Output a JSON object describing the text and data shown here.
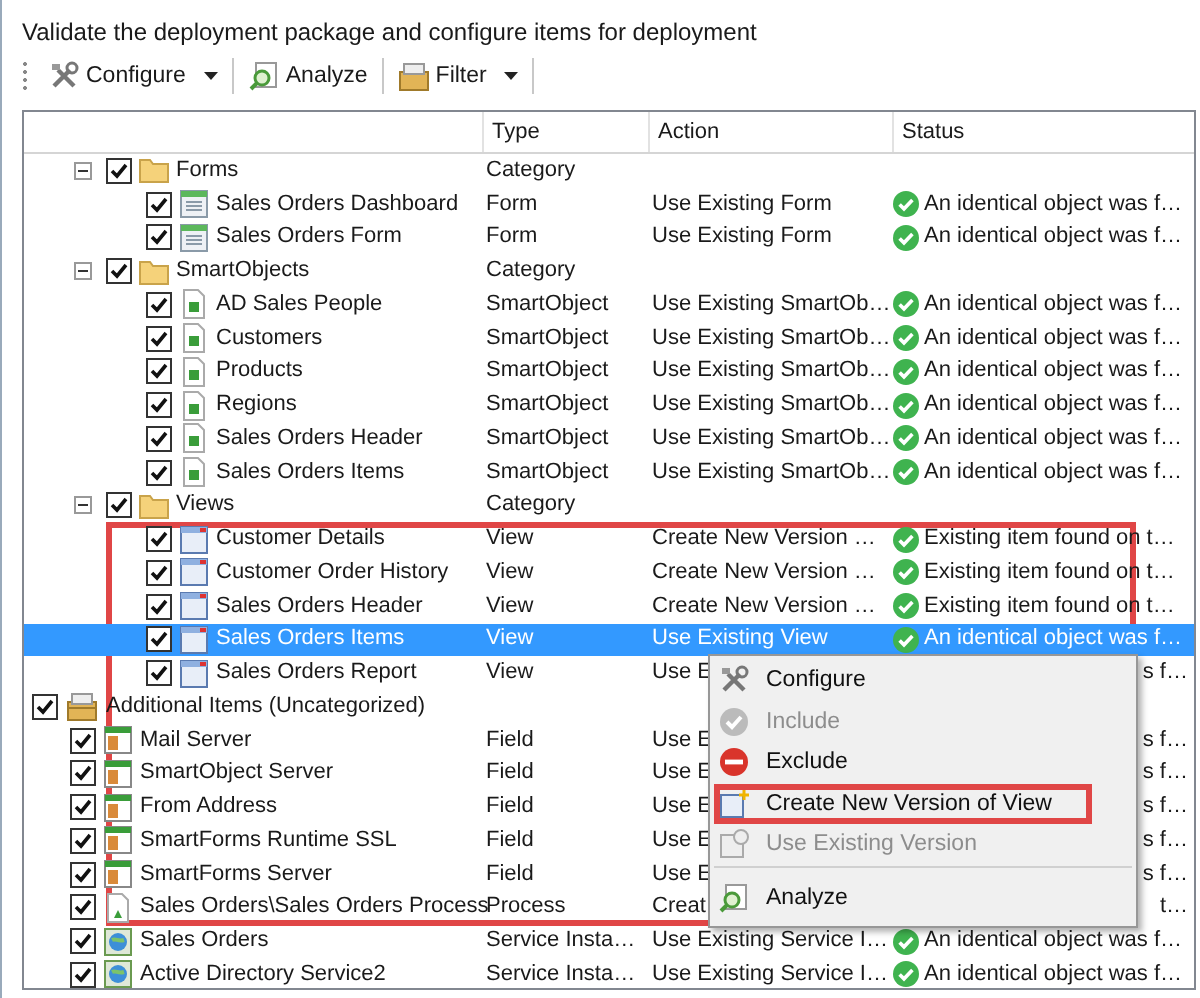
{
  "heading": "Validate the deployment package and configure items for deployment",
  "toolbar": [
    {
      "label": "Configure",
      "kind": "configure",
      "dropdown": true
    },
    {
      "label": "Analyze",
      "kind": "analyze",
      "dropdown": false
    },
    {
      "label": "Filter",
      "kind": "filter",
      "dropdown": true
    }
  ],
  "columns": [
    "Type",
    "Action",
    "Status"
  ],
  "tree": [
    {
      "children": [
        {
          "children": [
            {
              "label": "Forms",
              "kind": "folder",
              "checked": true,
              "expanded": true,
              "selected": false,
              "type": "Category",
              "children": [
                {
                  "label": "Sales Orders Dashboard",
                  "kind": "form",
                  "checked": true,
                  "selected": false,
                  "type": "Form",
                  "action": "Use Existing Form",
                  "status": {
                    "text": "An identical object was f…",
                    "partial": false
                  }
                },
                {
                  "label": "Sales Orders Form",
                  "kind": "form",
                  "checked": true,
                  "selected": false,
                  "type": "Form",
                  "action": "Use Existing Form",
                  "status": {
                    "text": "An identical object was f…",
                    "partial": false
                  }
                }
              ]
            },
            {
              "label": "SmartObjects",
              "kind": "folder",
              "checked": true,
              "expanded": true,
              "selected": false,
              "type": "Category",
              "children": [
                {
                  "label": "AD Sales People",
                  "kind": "smartobject",
                  "checked": true,
                  "selected": false,
                  "type": "SmartObject",
                  "action": "Use Existing SmartOb…",
                  "status": {
                    "text": "An identical object was f…",
                    "partial": false
                  }
                },
                {
                  "label": "Customers",
                  "kind": "smartobject",
                  "checked": true,
                  "selected": false,
                  "type": "SmartObject",
                  "action": "Use Existing SmartOb…",
                  "status": {
                    "text": "An identical object was f…",
                    "partial": false
                  }
                },
                {
                  "label": "Products",
                  "kind": "smartobject",
                  "checked": true,
                  "selected": false,
                  "type": "SmartObject",
                  "action": "Use Existing SmartOb…",
                  "status": {
                    "text": "An identical object was f…",
                    "partial": false
                  }
                },
                {
                  "label": "Regions",
                  "kind": "smartobject",
                  "checked": true,
                  "selected": false,
                  "type": "SmartObject",
                  "action": "Use Existing SmartOb…",
                  "status": {
                    "text": "An identical object was f…",
                    "partial": false
                  }
                },
                {
                  "label": "Sales Orders Header",
                  "kind": "smartobject",
                  "checked": true,
                  "selected": false,
                  "type": "SmartObject",
                  "action": "Use Existing SmartOb…",
                  "status": {
                    "text": "An identical object was f…",
                    "partial": false
                  }
                },
                {
                  "label": "Sales Orders Items",
                  "kind": "smartobject",
                  "checked": true,
                  "selected": false,
                  "type": "SmartObject",
                  "action": "Use Existing SmartOb…",
                  "status": {
                    "text": "An identical object was f…",
                    "partial": false
                  }
                }
              ]
            },
            {
              "label": "Views",
              "kind": "folder",
              "checked": true,
              "expanded": true,
              "selected": false,
              "type": "Category",
              "children": [
                {
                  "label": "Customer Details",
                  "kind": "view",
                  "checked": true,
                  "selected": false,
                  "type": "View",
                  "action": "Create New Version …",
                  "status": {
                    "text": "Existing item found on t…",
                    "partial": false
                  }
                },
                {
                  "label": "Customer Order History",
                  "kind": "view",
                  "checked": true,
                  "selected": false,
                  "type": "View",
                  "action": "Create New Version …",
                  "status": {
                    "text": "Existing item found on t…",
                    "partial": false
                  }
                },
                {
                  "label": "Sales Orders Header",
                  "kind": "view",
                  "checked": true,
                  "selected": false,
                  "type": "View",
                  "action": "Create New Version …",
                  "status": {
                    "text": "Existing item found on t…",
                    "partial": false
                  }
                },
                {
                  "label": "Sales Orders Items",
                  "kind": "view",
                  "checked": true,
                  "selected": true,
                  "type": "View",
                  "action": "Use Existing View",
                  "status": {
                    "text": "An identical object was f…",
                    "partial": false
                  }
                },
                {
                  "label": "Sales Orders Report",
                  "kind": "view",
                  "checked": true,
                  "selected": false,
                  "type": "View",
                  "action": "Use E",
                  "status": {
                    "text": "s f…",
                    "partial": true
                  }
                }
              ]
            }
          ]
        }
      ]
    },
    {
      "label": "Additional Items (Uncategorized)",
      "kind": "package",
      "checked": true,
      "selected": false,
      "children": [
        {
          "label": "Mail Server",
          "kind": "field",
          "checked": true,
          "selected": false,
          "type": "Field",
          "action": "Use E",
          "status": {
            "text": "s f…",
            "partial": true
          }
        },
        {
          "label": "SmartObject Server",
          "kind": "field",
          "checked": true,
          "selected": false,
          "type": "Field",
          "action": "Use E",
          "status": {
            "text": "s f…",
            "partial": true
          }
        },
        {
          "label": "From Address",
          "kind": "field",
          "checked": true,
          "selected": false,
          "type": "Field",
          "action": "Use E",
          "status": {
            "text": "s f…",
            "partial": true
          }
        },
        {
          "label": "SmartForms Runtime SSL",
          "kind": "field",
          "checked": true,
          "selected": false,
          "type": "Field",
          "action": "Use E",
          "status": {
            "text": "s f…",
            "partial": true
          }
        },
        {
          "label": "SmartForms Server",
          "kind": "field",
          "checked": true,
          "selected": false,
          "type": "Field",
          "action": "Use E",
          "status": {
            "text": "s f…",
            "partial": true
          }
        },
        {
          "label": "Sales Orders\\Sales Orders Process",
          "kind": "process",
          "checked": true,
          "selected": false,
          "type": "Process",
          "action": "Creat",
          "status": {
            "text": "t…",
            "partial": true
          }
        },
        {
          "label": "Sales Orders",
          "kind": "service",
          "checked": true,
          "selected": false,
          "type": "Service Insta…",
          "action": "Use Existing Service I…",
          "status": {
            "text": "An identical object was f…",
            "partial": false
          }
        },
        {
          "label": "Active Directory Service2",
          "kind": "service",
          "checked": true,
          "selected": false,
          "type": "Service Insta…",
          "action": "Use Existing Service I…",
          "status": {
            "text": "An identical object was f…",
            "partial": false
          }
        }
      ]
    }
  ],
  "context_menu": [
    {
      "label": "Configure",
      "kind": "configure",
      "disabled": false,
      "highlighted": false
    },
    {
      "label": "Include",
      "kind": "include",
      "disabled": true,
      "highlighted": false
    },
    {
      "label": "Exclude",
      "kind": "exclude",
      "disabled": false,
      "highlighted": false
    },
    {
      "label": "Create New Version of View",
      "kind": "newversion",
      "disabled": false,
      "highlighted": true
    },
    {
      "label": "Use Existing Version",
      "kind": "existing",
      "disabled": true,
      "highlighted": false
    },
    {
      "label": "Analyze",
      "kind": "analyze",
      "disabled": false,
      "highlighted": false,
      "separator_before": true
    }
  ]
}
